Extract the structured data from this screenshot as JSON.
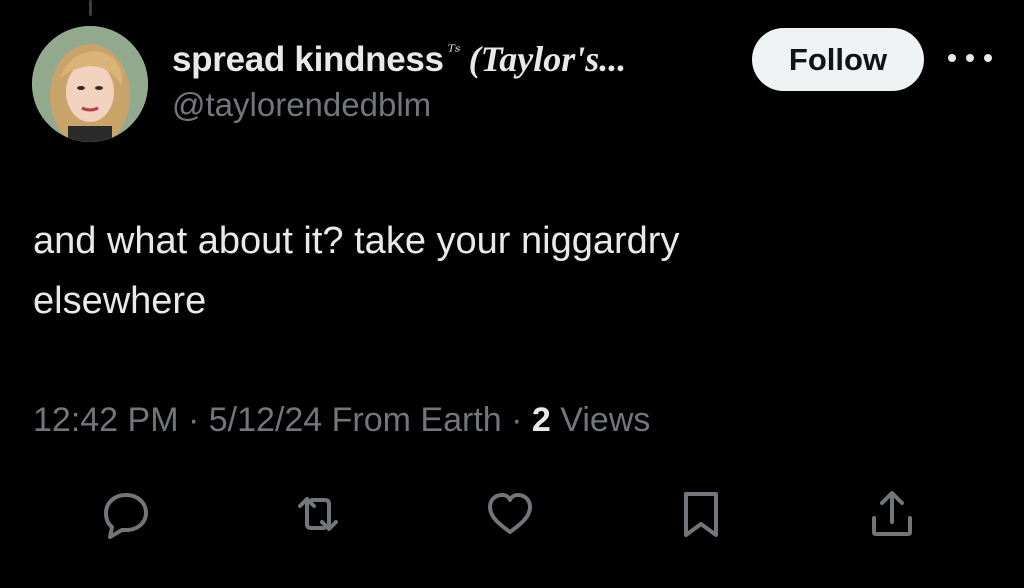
{
  "tweet": {
    "display_name": "spread kindness",
    "name_badge": "ᵀˢ",
    "name_suffix": "(Taylor's...",
    "handle": "@taylorendedblm",
    "follow_label": "Follow",
    "text_line1": "and what about it? take your niggardry",
    "text_line2": "elsewhere",
    "time": "12:42 PM",
    "date": "5/12/24 From Earth",
    "separator": "·",
    "views_count": "2",
    "views_label": "Views"
  },
  "icons": {
    "more": "more-dots-icon",
    "reply": "reply-bubble-icon",
    "retweet": "retweet-icon",
    "like": "heart-icon",
    "bookmark": "bookmark-icon",
    "share": "share-icon"
  },
  "colors": {
    "background": "#000000",
    "primary_text": "#e7e9ea",
    "secondary_text": "#71767b",
    "follow_bg": "#eff3f4"
  }
}
